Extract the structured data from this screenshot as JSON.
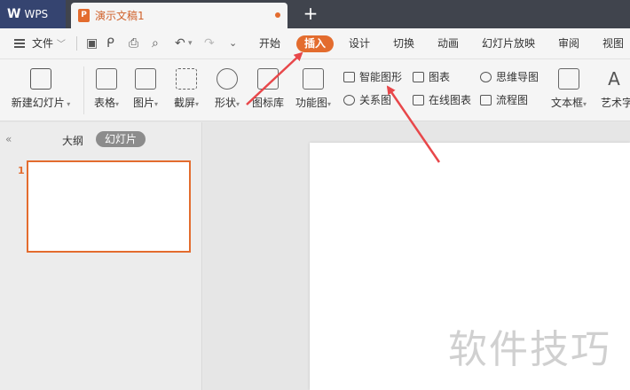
{
  "titlebar": {
    "app_label": "WPS",
    "doc_tab_label": "演示文稿1",
    "doc_icon_letter": "P",
    "new_tab": "+"
  },
  "menubar": {
    "file_label": "文件",
    "tabs": [
      "开始",
      "插入",
      "设计",
      "切换",
      "动画",
      "幻灯片放映",
      "审阅",
      "视图"
    ],
    "active_tab": "插入"
  },
  "ribbon": {
    "new_slide": "新建幻灯片",
    "table": "表格",
    "picture": "图片",
    "screenshot": "截屏",
    "shape": "形状",
    "icon_lib": "图标库",
    "function_chart": "功能图",
    "smart_art": "智能图形",
    "relation": "关系图",
    "chart": "图表",
    "online_chart": "在线图表",
    "mind_map": "思维导图",
    "flowchart": "流程图",
    "textbox": "文本框",
    "art_text": "艺术字"
  },
  "leftpanel": {
    "collapse": "«",
    "outline_tab": "大纲",
    "slides_tab": "幻灯片",
    "thumb_number": "1"
  },
  "watermark": "软件技巧",
  "colors": {
    "accent": "#e36c2e",
    "titlebar_bg": "#40444d",
    "wps_tab_bg": "#354470",
    "arrow": "#e8474a"
  }
}
